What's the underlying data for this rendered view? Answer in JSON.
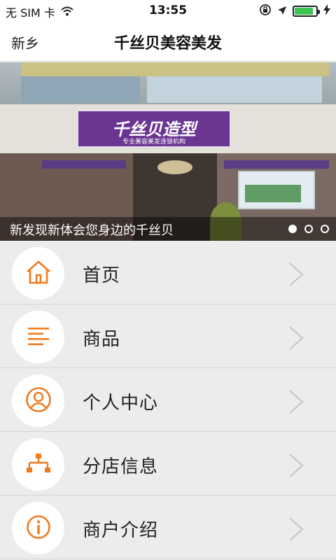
{
  "status_bar": {
    "carrier": "无 SIM 卡",
    "time": "13:55",
    "battery_level": 0.85
  },
  "navbar": {
    "city": "新乡",
    "title": "千丝贝美容美发"
  },
  "banner": {
    "caption": "新发现新体会您身边的千丝贝",
    "sign_text": "千丝贝造型",
    "sign_subtext": "专业美容美发连锁机构",
    "slide_count": 3,
    "active_slide": 1
  },
  "menu": {
    "items": [
      {
        "label": "首页",
        "icon": "home-icon"
      },
      {
        "label": "商品",
        "icon": "list-icon"
      },
      {
        "label": "个人中心",
        "icon": "user-icon"
      },
      {
        "label": "分店信息",
        "icon": "branches-icon"
      },
      {
        "label": "商户介绍",
        "icon": "info-icon"
      }
    ]
  },
  "colors": {
    "accent": "#f07a1d",
    "background": "#ececec",
    "chevron": "#c4c4c4"
  }
}
